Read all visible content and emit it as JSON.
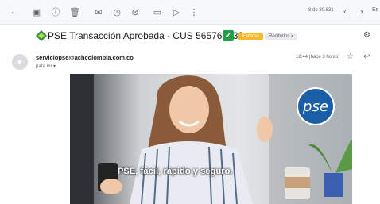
{
  "toolbar": {
    "icons": [
      "back-icon",
      "archive-icon",
      "report-icon",
      "delete-icon",
      "mark-unread-icon",
      "snooze-icon",
      "add-task-icon",
      "move-icon",
      "label-icon",
      "more-icon"
    ],
    "pagination": "8 de 30.631",
    "prev_icon": "chevron-left-icon",
    "next_icon": "chevron-right-icon",
    "lang": "Es"
  },
  "email": {
    "subject": "PSE Transacción Aprobada - CUS 565761632",
    "labels": [
      "Externo",
      "Recibidos x"
    ],
    "sender": "serviciopse@achcolombia.com.co",
    "to": "para mí ▾",
    "time": "18:44 (hace 3 horas)"
  },
  "banner": {
    "tagline": "PSE, fácil, rápido y seguro.",
    "logo_text": "pse"
  }
}
